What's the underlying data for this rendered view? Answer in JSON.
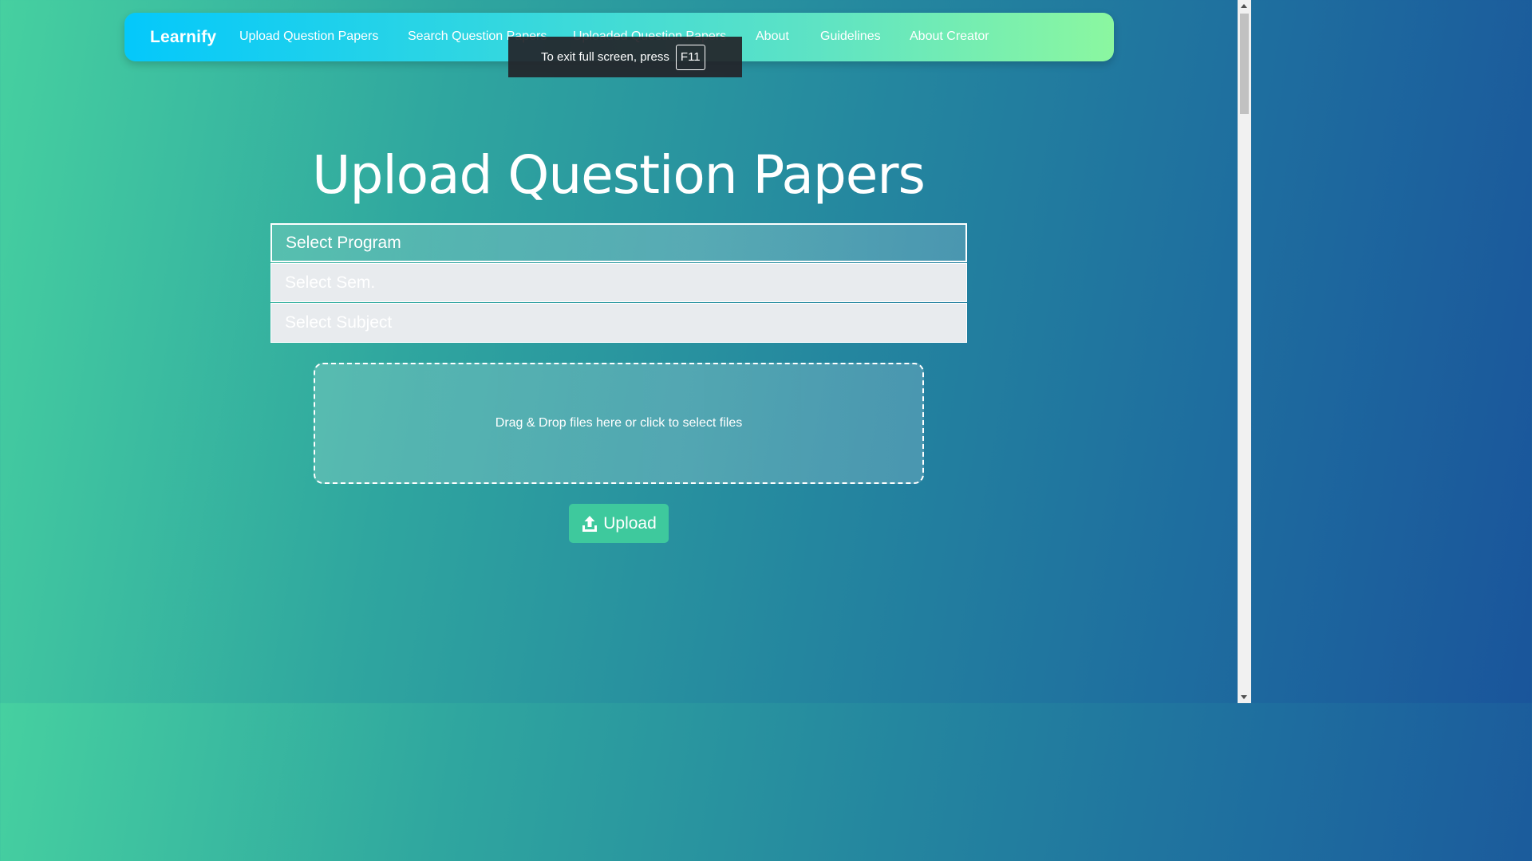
{
  "navbar": {
    "brand": "Learnify",
    "links": [
      {
        "label": "Upload Question Papers"
      },
      {
        "label": "Search Question Papers"
      },
      {
        "label": "Uploaded Question Papers"
      },
      {
        "label": "About"
      },
      {
        "label": "Guidelines"
      },
      {
        "label": "About Creator"
      }
    ]
  },
  "fullscreen_toast": {
    "text": "To exit full screen, press",
    "key": "F11"
  },
  "page": {
    "title": "Upload Question Papers"
  },
  "form": {
    "program_select": "Select Program",
    "sem_select": "Select Sem.",
    "subject_select": "Select Subject",
    "dropzone_text": "Drag & Drop files here or click to select files",
    "upload_label": "Upload",
    "upload_icon": "upload-icon"
  },
  "colors": {
    "upload_button": "#3ec99d",
    "navbar_start": "#04c8fb",
    "navbar_end": "#8bf7a0"
  }
}
